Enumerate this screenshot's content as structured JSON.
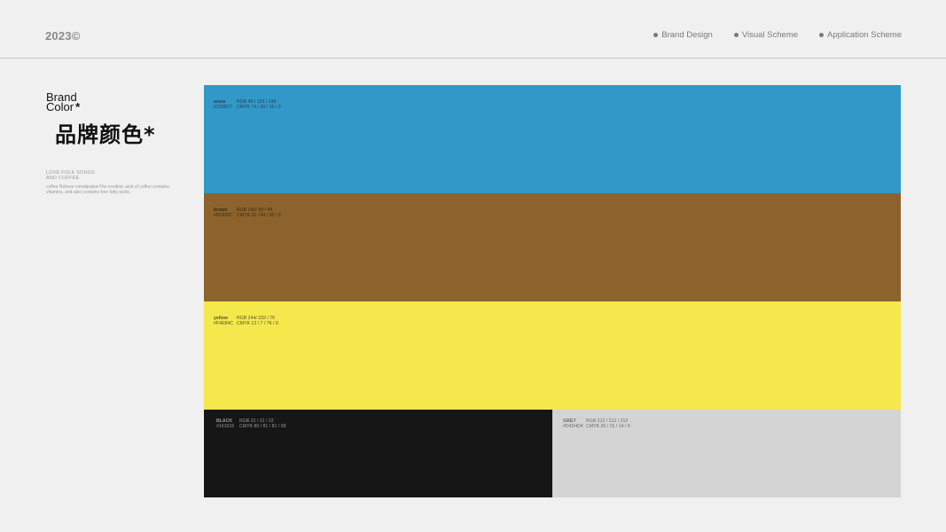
{
  "header": {
    "year": "2023©",
    "nav": [
      {
        "label": "Brand Design"
      },
      {
        "label": "Visual Scheme"
      },
      {
        "label": "Application Scheme"
      }
    ]
  },
  "intro": {
    "title_line1": "Brand",
    "title_line2": "Color",
    "title_asterisk": "*",
    "cn_title": "品牌颜色*",
    "tagline_line1": "LOVE FOLK SONGS",
    "tagline_line2": "AND COFFEE",
    "description": "coffee Relieve constipationThe nicotinic acid of coffee contains vitamins, and also contains free fatty acids,"
  },
  "palette": [
    {
      "name": "azure",
      "rgb": "RGB 49 / 153 / 199",
      "hex": "#3199C7",
      "cmyk": "CMYK 74 / 30 / 16 / 0",
      "color": "#3199C7",
      "text_color": "#2a3c55"
    },
    {
      "name": "brown",
      "rgb": "RGB 140/ 99 / 44",
      "hex": "#8C632C",
      "cmyk": "CMYK 31 / 64 / 96 / 0",
      "color": "#8C632C",
      "text_color": "#3a2a14"
    },
    {
      "name": "yellow",
      "rgb": "RGB 244/ 232 / 76",
      "hex": "#F4E84C",
      "cmyk": "CMYK 12 / 7 / 76 / 0",
      "color": "#F4E84C",
      "text_color": "#5a5420"
    },
    {
      "name": "BLACK",
      "rgb": "RGB 22 / 22 / 22",
      "hex": "#161616",
      "cmyk": "CMYK 86 / 81 / 81 / 68",
      "color": "#161616",
      "text_color": "#9a9a9a"
    },
    {
      "name": "GREY",
      "rgb": "RGB 212 / 212 / 212",
      "hex": "#D4D4D4",
      "cmyk": "CMYK 20 / 15 / 14 / 0",
      "color": "#D4D4D4",
      "text_color": "#6a6a6a"
    }
  ]
}
